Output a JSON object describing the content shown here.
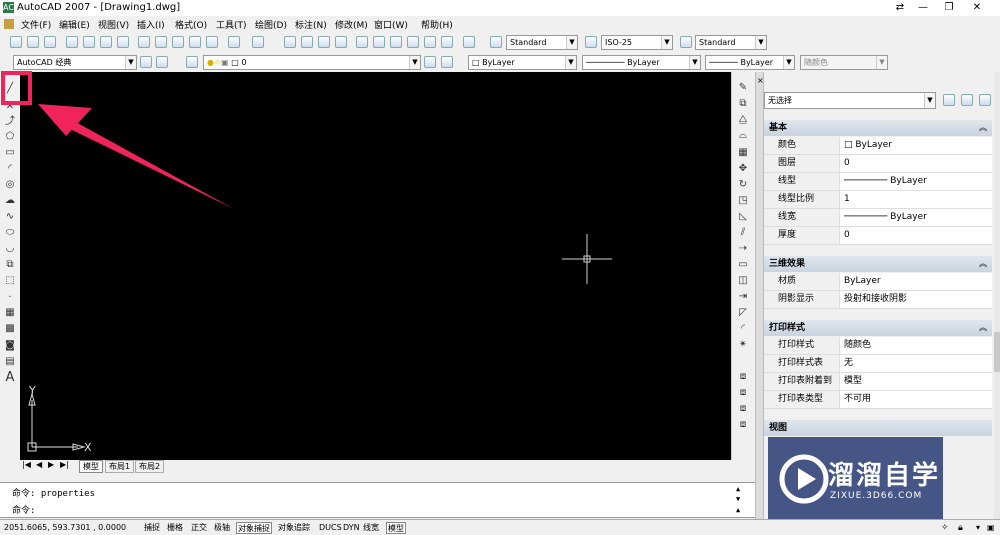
{
  "titlebar": {
    "title": "AutoCAD 2007 - [Drawing1.dwg]",
    "app_icon": "AC",
    "restore": "⇄",
    "minimize": "—",
    "maximize": "❐",
    "close": "✕"
  },
  "menu": [
    "文件(F)",
    "编辑(E)",
    "视图(V)",
    "插入(I)",
    "格式(O)",
    "工具(T)",
    "绘图(D)",
    "标注(N)",
    "修改(M)",
    "窗口(W)",
    "帮助(H)"
  ],
  "toolbar": {
    "text_style": "Standard",
    "dim_style": "ISO-25",
    "table_style": "Standard",
    "workspace": "AutoCAD 经典",
    "layer": "0",
    "color": "ByLayer",
    "linetype": "ByLayer",
    "lineweight": "ByLayer",
    "plotstyle": "随颜色"
  },
  "properties": {
    "selection": "无选择",
    "basic": {
      "title": "基本",
      "rows": [
        {
          "k": "颜色",
          "v": "ByLayer"
        },
        {
          "k": "图层",
          "v": "0"
        },
        {
          "k": "线型",
          "v": "ByLayer"
        },
        {
          "k": "线型比例",
          "v": "1"
        },
        {
          "k": "线宽",
          "v": "ByLayer"
        },
        {
          "k": "厚度",
          "v": "0"
        }
      ]
    },
    "threed": {
      "title": "三维效果",
      "rows": [
        {
          "k": "材质",
          "v": "ByLayer"
        },
        {
          "k": "阴影显示",
          "v": "投射和接收阴影"
        }
      ]
    },
    "plot": {
      "title": "打印样式",
      "rows": [
        {
          "k": "打印样式",
          "v": "随颜色"
        },
        {
          "k": "打印样式表",
          "v": "无"
        },
        {
          "k": "打印表附着到",
          "v": "模型"
        },
        {
          "k": "打印表类型",
          "v": "不可用"
        }
      ]
    },
    "view": {
      "title": "视图"
    }
  },
  "ucs": {
    "y": "Y",
    "x": "X"
  },
  "tabs": [
    "模型",
    "布局1",
    "布局2"
  ],
  "command": {
    "line1": "命令: properties",
    "line2": "命令:"
  },
  "status": {
    "coords": "2051.6065, 593.7301 , 0.0000",
    "buttons": [
      "捕捉",
      "栅格",
      "正交",
      "极轴",
      "对象捕捉",
      "对象追踪",
      "DUCS",
      "DYN",
      "线宽",
      "模型"
    ]
  },
  "watermark": {
    "name": "溜溜自学",
    "url": "ZIXUE.3D66.COM"
  },
  "annotation_color": "#f0245a",
  "canvas_color": "#000000"
}
